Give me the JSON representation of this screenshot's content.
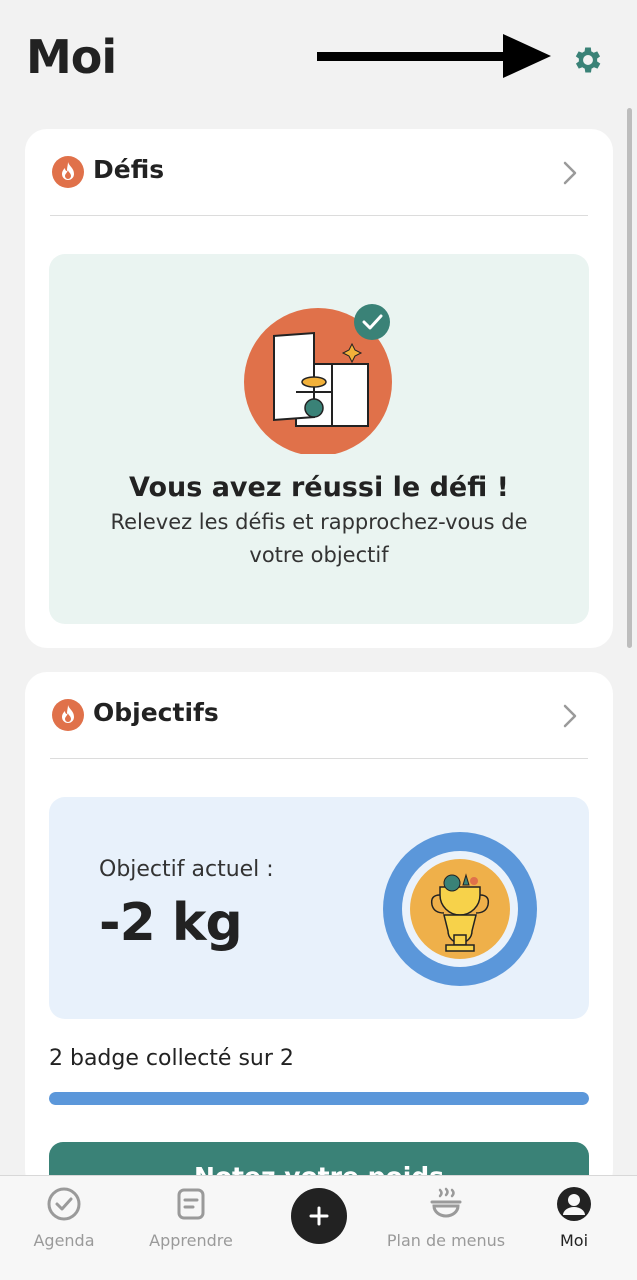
{
  "header": {
    "title": "Moi",
    "settings_icon": "gear-icon"
  },
  "colors": {
    "accent": "#3a8277",
    "flame": "#e0714a",
    "progress": "#5b97da",
    "badge_ring": "#5b97da"
  },
  "defis": {
    "title": "Défis",
    "card_title": "Vous avez réussi le défi !",
    "subtitle": "Relevez les défis et rapprochez-vous de votre objectif"
  },
  "objectifs": {
    "title": "Objectifs",
    "current_label": "Objectif actuel :",
    "current_value": "-2 kg",
    "badge_text": "2 badge collecté sur 2",
    "progress": 1.0,
    "cta_label": "Notez votre poids"
  },
  "tabbar": {
    "tabs": [
      {
        "label": "Agenda",
        "icon": "check-circle-icon"
      },
      {
        "label": "Apprendre",
        "icon": "note-icon"
      },
      {
        "label": "",
        "icon": "plus-icon"
      },
      {
        "label": "Plan de menus",
        "icon": "bowl-icon"
      },
      {
        "label": "Moi",
        "icon": "profile-icon"
      }
    ],
    "active": "Moi"
  }
}
